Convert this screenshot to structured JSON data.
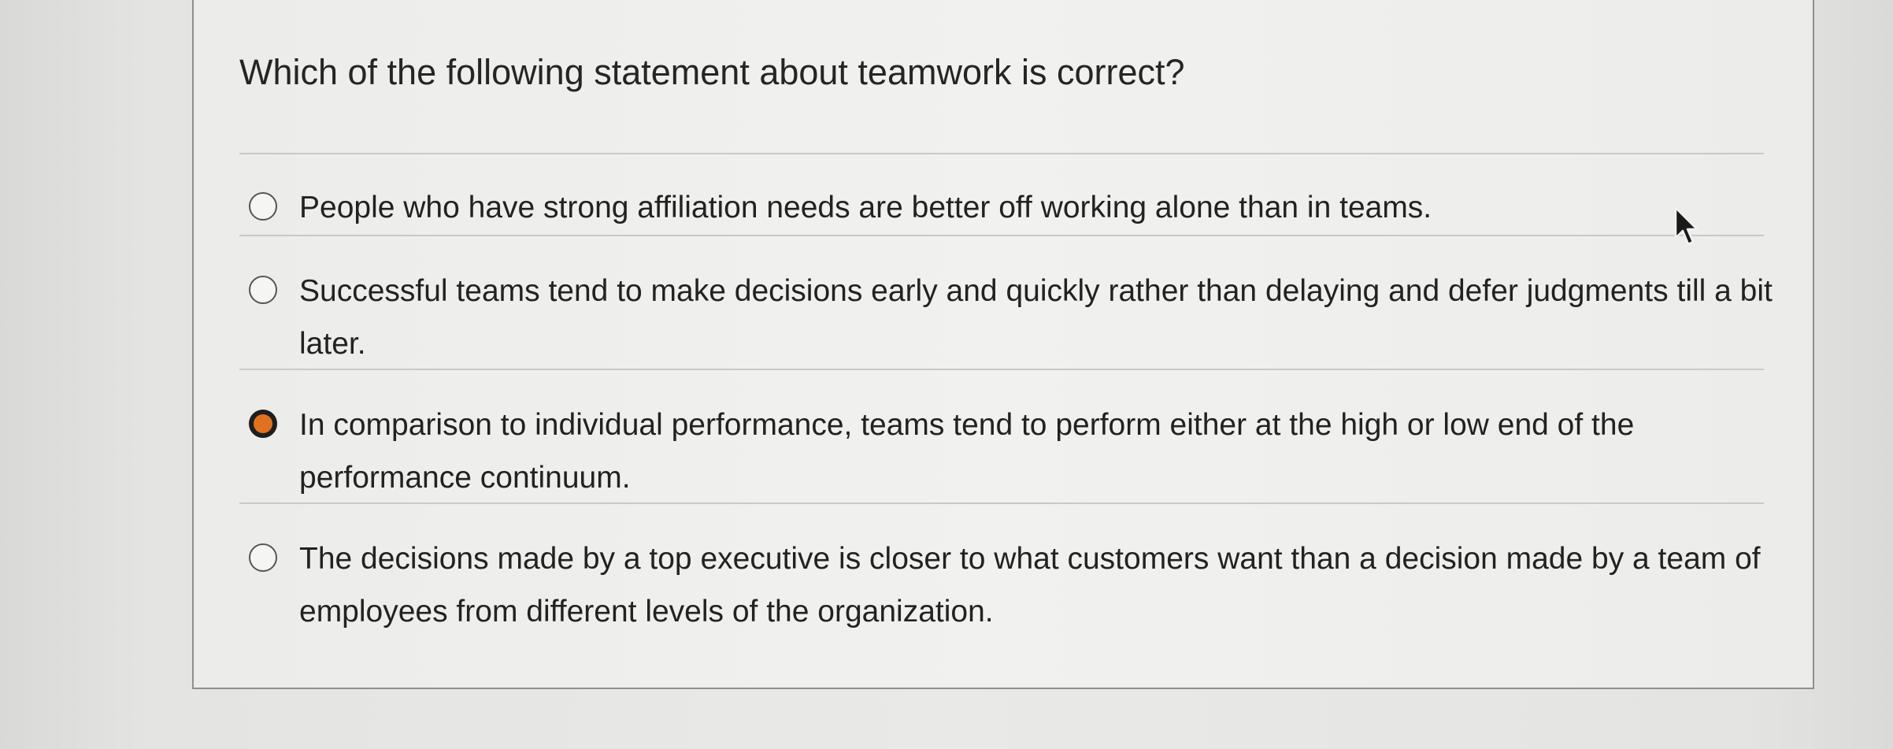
{
  "question": {
    "text": "Which of the following statement about teamwork is correct?"
  },
  "options": [
    {
      "text": "People who have strong affiliation needs are better off working alone than in teams.",
      "selected": false
    },
    {
      "text": "Successful teams tend to make decisions early and quickly rather than delaying and defer judgments till a bit later.",
      "selected": false
    },
    {
      "text": "In comparison to individual performance, teams tend to perform either at the high or low end of the performance continuum.",
      "selected": true
    },
    {
      "text": "The decisions made by a top executive is closer to what customers want than a decision made by a team of employees from different levels of the organization.",
      "selected": false
    }
  ],
  "colors": {
    "selected_fill": "#e0711e",
    "selected_ring": "#1e1e1e",
    "radio_border": "#555555",
    "divider": "#c9c9c7",
    "card_border": "#8f8f8d"
  },
  "icons": {
    "pointer": "mouse-pointer-icon"
  }
}
